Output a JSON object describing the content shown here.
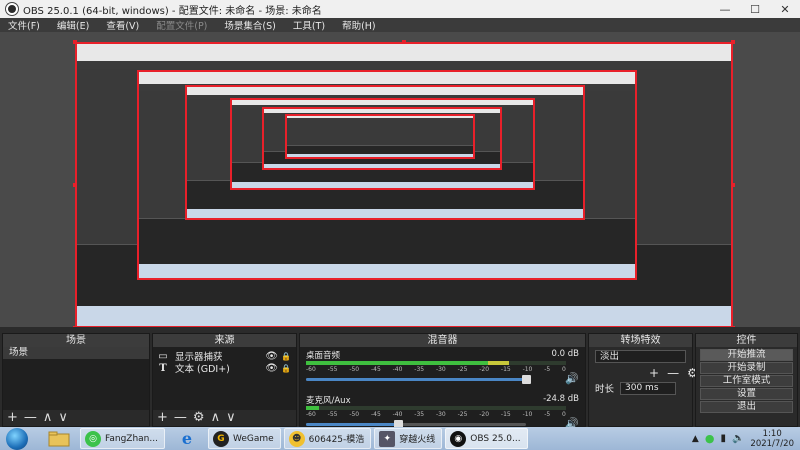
{
  "window": {
    "title": "OBS 25.0.1 (64-bit, windows) - 配置文件: 未命名 - 场景: 未命名",
    "minimize": "—",
    "maximize": "☐",
    "close": "✕"
  },
  "menu": {
    "items": [
      {
        "label": "文件(F)",
        "enabled": true
      },
      {
        "label": "编辑(E)",
        "enabled": true
      },
      {
        "label": "查看(V)",
        "enabled": true
      },
      {
        "label": "配置文件(P)",
        "enabled": false
      },
      {
        "label": "场景集合(S)",
        "enabled": true
      },
      {
        "label": "工具(T)",
        "enabled": true
      },
      {
        "label": "帮助(H)",
        "enabled": true
      }
    ]
  },
  "colors": {
    "selection_border": "#e8202a",
    "meter_green": "#3fbf3f",
    "meter_yellow": "#c8c83a",
    "meter_red": "#c83a3a",
    "slider_blue": "#4a86c5"
  },
  "docks": {
    "scenes": {
      "title": "场景",
      "items": [
        "场景"
      ],
      "footer": [
        "+",
        "—",
        "∧",
        "∨"
      ]
    },
    "sources": {
      "title": "来源",
      "items": [
        {
          "icon": "monitor-icon",
          "glyph": "▭",
          "label": "显示器捕获"
        },
        {
          "icon": "text-icon",
          "glyph": "T",
          "label": "文本 (GDI+)"
        }
      ],
      "footer": [
        "+",
        "—",
        "⚙",
        "∧",
        "∨"
      ]
    },
    "mixer": {
      "title": "混音器",
      "ticks": [
        "-60",
        "-55",
        "-50",
        "-45",
        "-40",
        "-35",
        "-30",
        "-25",
        "-20",
        "-15",
        "-10",
        "-5",
        "0"
      ],
      "channels": [
        {
          "name": "桌面音频",
          "db": "0.0 dB",
          "level": 0.78,
          "volume": 1.0
        },
        {
          "name": "麦克风/Aux",
          "db": "-24.8 dB",
          "level": 0.05,
          "volume": 0.42
        }
      ]
    },
    "transitions": {
      "title": "转场特效",
      "selected": "淡出",
      "duration_label": "时长",
      "duration_value": "300 ms",
      "add": "+",
      "remove": "—",
      "gear": "⚙"
    },
    "controls": {
      "title": "控件",
      "buttons": [
        "开始推流",
        "开始录制",
        "工作室模式",
        "设置",
        "退出"
      ]
    }
  },
  "taskbar": {
    "buttons": [
      {
        "label": "FangZhan...",
        "icon": "fangzhan-icon"
      },
      {
        "label": "WeGame",
        "icon": "wegame-icon"
      },
      {
        "label": "606425-模浩",
        "icon": "character-app-icon"
      },
      {
        "label": "穿越火线",
        "icon": "crossfire-icon"
      },
      {
        "label": "OBS 25.0...",
        "icon": "obs-icon"
      }
    ],
    "time": "1:10",
    "date": "2021/7/20"
  }
}
